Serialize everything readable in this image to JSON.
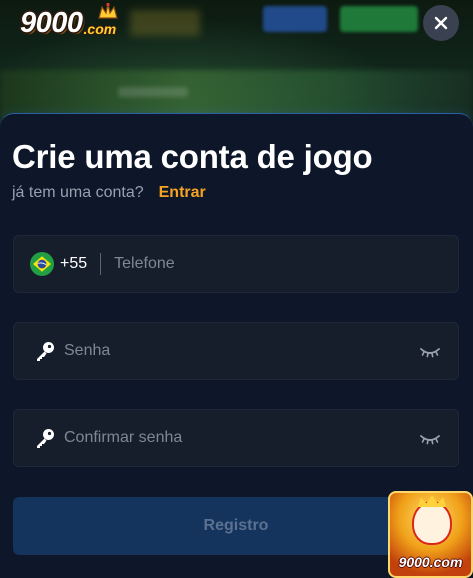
{
  "background": {
    "logo_number": "9000",
    "logo_suffix": ".com"
  },
  "modal": {
    "title": "Crie uma conta de jogo",
    "have_account_text": "já tem uma conta?",
    "login_link": "Entrar",
    "phone": {
      "country_code": "+55",
      "placeholder": "Telefone",
      "value": "",
      "flag": "brazil-flag-icon"
    },
    "password": {
      "placeholder": "Senha",
      "value": "",
      "icon": "key-icon"
    },
    "confirm_password": {
      "placeholder": "Confirmar senha",
      "value": "",
      "icon": "key-icon"
    },
    "submit_label": "Registro"
  },
  "promo": {
    "label": "9000.com"
  },
  "colors": {
    "accent": "#f5a321",
    "modal_bg": "#0e1729",
    "field_bg": "#161e2c",
    "submit_bg": "#14345e"
  }
}
